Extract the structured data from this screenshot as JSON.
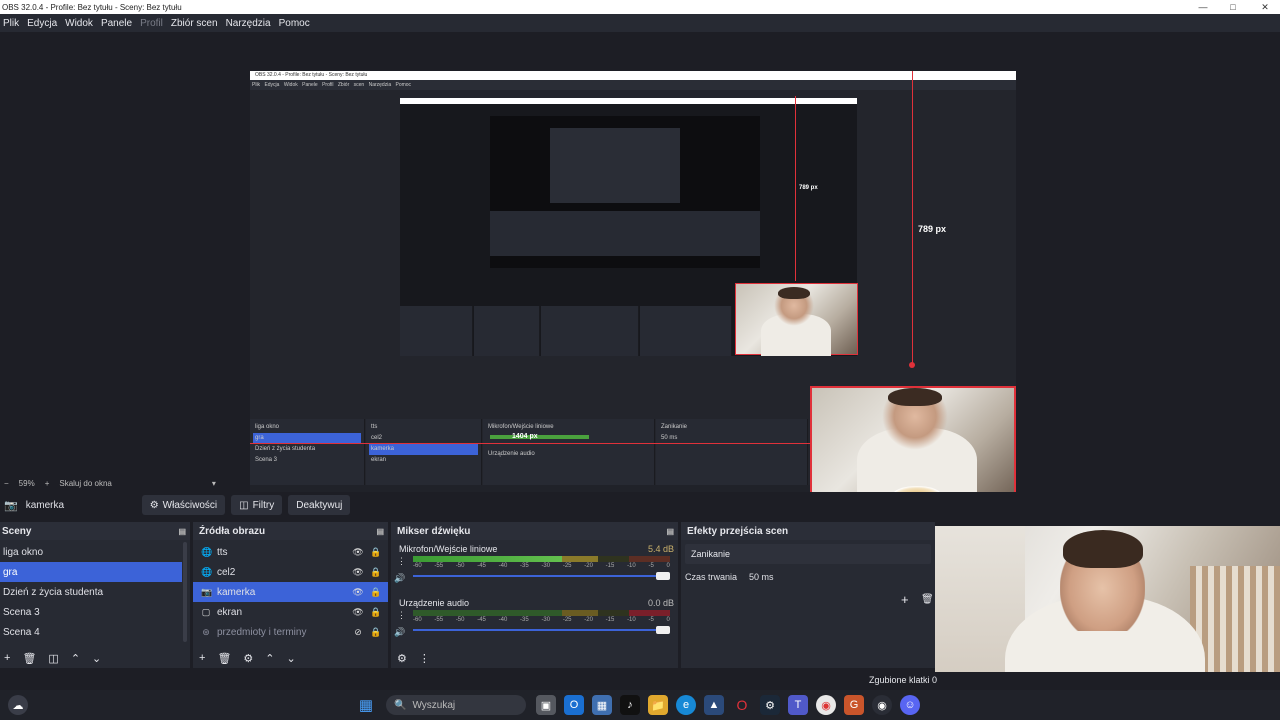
{
  "window": {
    "title": "OBS 32.0.4 - Profile: Bez tytułu - Sceny: Bez tytułu"
  },
  "menu": [
    "Plik",
    "Edycja",
    "Widok",
    "Panele",
    "Profil",
    "Zbiór scen",
    "Narzędzia",
    "Pomoc"
  ],
  "preview": {
    "measure_vertical": "789 px",
    "measure_inner": "789 px",
    "measure_horizontal": "1404 px",
    "mini_title": "OBS 32.0.4 - Profile: Bez tytułu - Sceny: Bez tytułu",
    "mini_menu": "Plik Edycja Widok Panele Profil Zbiór scen Narzędzia Pomoc"
  },
  "status_line": {
    "zoom": "59%",
    "scale_label": "Skaluj do okna"
  },
  "source_controls": {
    "selected_source": "kamerka",
    "properties_label": "Właściwości",
    "filters_label": "Filtry",
    "deactivate_label": "Deaktywuj"
  },
  "scenes": {
    "title": "Sceny",
    "items": [
      "liga okno",
      "gra",
      "Dzień z życia studenta",
      "Scena 3",
      "Scena 4"
    ],
    "selected_index": 1
  },
  "sources": {
    "title": "Źródła obrazu",
    "items": [
      {
        "name": "tts",
        "icon": "globe-icon"
      },
      {
        "name": "cel2",
        "icon": "globe-icon"
      },
      {
        "name": "kamerka",
        "icon": "camera-icon"
      },
      {
        "name": "ekran",
        "icon": "monitor-icon"
      },
      {
        "name": "przedmioty i terminy",
        "icon": "group-icon"
      }
    ]
  },
  "mixer": {
    "title": "Mikser dźwięku",
    "channels": [
      {
        "name": "Mikrofon/Wejście liniowe",
        "db": "5.4 dB",
        "level": 0.72
      },
      {
        "name": "Urządzenie audio",
        "db": "0.0 dB",
        "level": 0.0
      }
    ],
    "ticks": [
      "-60",
      "-55",
      "-50",
      "-45",
      "-40",
      "-35",
      "-30",
      "-25",
      "-20",
      "-15",
      "-10",
      "-5",
      "0"
    ]
  },
  "transitions": {
    "title": "Efekty przejścia scen",
    "selected": "Zanikanie",
    "duration_label": "Czas trwania",
    "duration_value": "50 ms"
  },
  "statusbar": {
    "dropped_frames": "Zgubione klatki 0"
  },
  "taskbar": {
    "search_placeholder": "Wyszukaj"
  },
  "colors": {
    "accent": "#3c63d8",
    "selection_red": "#e0313a",
    "panel": "#272a33",
    "bg": "#1d1e25"
  }
}
